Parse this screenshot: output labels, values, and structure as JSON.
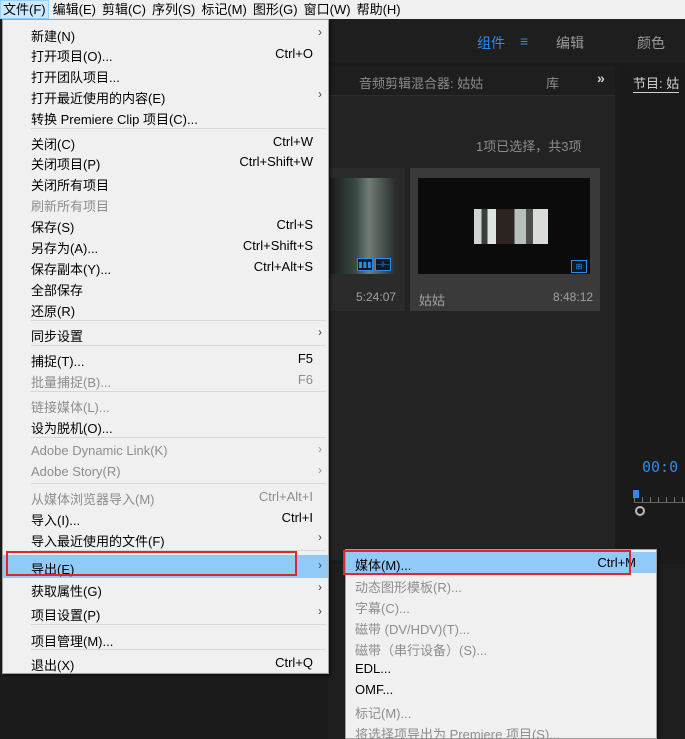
{
  "menubar": {
    "items": [
      "文件(F)",
      "编辑(E)",
      "剪辑(C)",
      "序列(S)",
      "标记(M)",
      "图形(G)",
      "窗口(W)",
      "帮助(H)"
    ],
    "active_index": 0
  },
  "workspace": {
    "tabs": [
      "组件",
      "编辑",
      "颜色"
    ],
    "active_tab": "组件",
    "menu_icon": "≡"
  },
  "panels": {
    "tabs": [
      "音频剪辑混合器: 姑姑",
      "库"
    ],
    "overflow_icon": "»",
    "program_tab": "节目: 姑",
    "selection_status": "1项已选择，共3项"
  },
  "clips": [
    {
      "name": "",
      "duration": "5:24:07"
    },
    {
      "name": "姑姑",
      "duration": "8:48:12"
    }
  ],
  "program": {
    "timecode": "00:0"
  },
  "file_menu": {
    "items": [
      {
        "label": "新建(N)",
        "shortcut": "",
        "submenu": true,
        "disabled": false
      },
      {
        "label": "打开项目(O)...",
        "shortcut": "Ctrl+O",
        "submenu": false,
        "disabled": false
      },
      {
        "label": "打开团队项目...",
        "shortcut": "",
        "submenu": false,
        "disabled": false
      },
      {
        "label": "打开最近使用的内容(E)",
        "shortcut": "",
        "submenu": true,
        "disabled": false
      },
      {
        "label": "转换 Premiere Clip 项目(C)...",
        "shortcut": "",
        "submenu": false,
        "disabled": false
      },
      {
        "label": "关闭(C)",
        "shortcut": "Ctrl+W",
        "submenu": false,
        "disabled": false
      },
      {
        "label": "关闭项目(P)",
        "shortcut": "Ctrl+Shift+W",
        "submenu": false,
        "disabled": false
      },
      {
        "label": "关闭所有项目",
        "shortcut": "",
        "submenu": false,
        "disabled": false
      },
      {
        "label": "刷新所有项目",
        "shortcut": "",
        "submenu": false,
        "disabled": true
      },
      {
        "label": "保存(S)",
        "shortcut": "Ctrl+S",
        "submenu": false,
        "disabled": false
      },
      {
        "label": "另存为(A)...",
        "shortcut": "Ctrl+Shift+S",
        "submenu": false,
        "disabled": false
      },
      {
        "label": "保存副本(Y)...",
        "shortcut": "Ctrl+Alt+S",
        "submenu": false,
        "disabled": false
      },
      {
        "label": "全部保存",
        "shortcut": "",
        "submenu": false,
        "disabled": false
      },
      {
        "label": "还原(R)",
        "shortcut": "",
        "submenu": false,
        "disabled": false
      },
      {
        "label": "同步设置",
        "shortcut": "",
        "submenu": true,
        "disabled": false
      },
      {
        "label": "捕捉(T)...",
        "shortcut": "F5",
        "submenu": false,
        "disabled": false
      },
      {
        "label": "批量捕捉(B)...",
        "shortcut": "F6",
        "submenu": false,
        "disabled": true
      },
      {
        "label": "链接媒体(L)...",
        "shortcut": "",
        "submenu": false,
        "disabled": true
      },
      {
        "label": "设为脱机(O)...",
        "shortcut": "",
        "submenu": false,
        "disabled": false
      },
      {
        "label": "Adobe Dynamic Link(K)",
        "shortcut": "",
        "submenu": true,
        "disabled": true
      },
      {
        "label": "Adobe Story(R)",
        "shortcut": "",
        "submenu": true,
        "disabled": true
      },
      {
        "label": "从媒体浏览器导入(M)",
        "shortcut": "Ctrl+Alt+I",
        "submenu": false,
        "disabled": true
      },
      {
        "label": "导入(I)...",
        "shortcut": "Ctrl+I",
        "submenu": false,
        "disabled": false
      },
      {
        "label": "导入最近使用的文件(F)",
        "shortcut": "",
        "submenu": true,
        "disabled": false
      },
      {
        "label": "导出(E)",
        "shortcut": "",
        "submenu": true,
        "disabled": false,
        "highlighted": true
      },
      {
        "label": "获取属性(G)",
        "shortcut": "",
        "submenu": true,
        "disabled": false
      },
      {
        "label": "项目设置(P)",
        "shortcut": "",
        "submenu": true,
        "disabled": false
      },
      {
        "label": "项目管理(M)...",
        "shortcut": "",
        "submenu": false,
        "disabled": false
      },
      {
        "label": "退出(X)",
        "shortcut": "Ctrl+Q",
        "submenu": false,
        "disabled": false
      }
    ]
  },
  "export_submenu": {
    "items": [
      {
        "label": "媒体(M)...",
        "shortcut": "Ctrl+M",
        "disabled": false,
        "highlighted": true
      },
      {
        "label": "动态图形模板(R)...",
        "shortcut": "",
        "disabled": true
      },
      {
        "label": "字幕(C)...",
        "shortcut": "",
        "disabled": true
      },
      {
        "label": "磁带 (DV/HDV)(T)...",
        "shortcut": "",
        "disabled": true
      },
      {
        "label": "磁带（串行设备）(S)...",
        "shortcut": "",
        "disabled": true
      },
      {
        "label": "EDL...",
        "shortcut": "",
        "disabled": false
      },
      {
        "label": "OMF...",
        "shortcut": "",
        "disabled": false
      },
      {
        "label": "标记(M)...",
        "shortcut": "",
        "disabled": true
      },
      {
        "label": "将选择项导出为 Premiere 项目(S)...",
        "shortcut": "",
        "disabled": true
      }
    ]
  },
  "colors": {
    "accent": "#2d8ceb",
    "highlight": "#91c9f7",
    "annotation": "#e0262c"
  }
}
